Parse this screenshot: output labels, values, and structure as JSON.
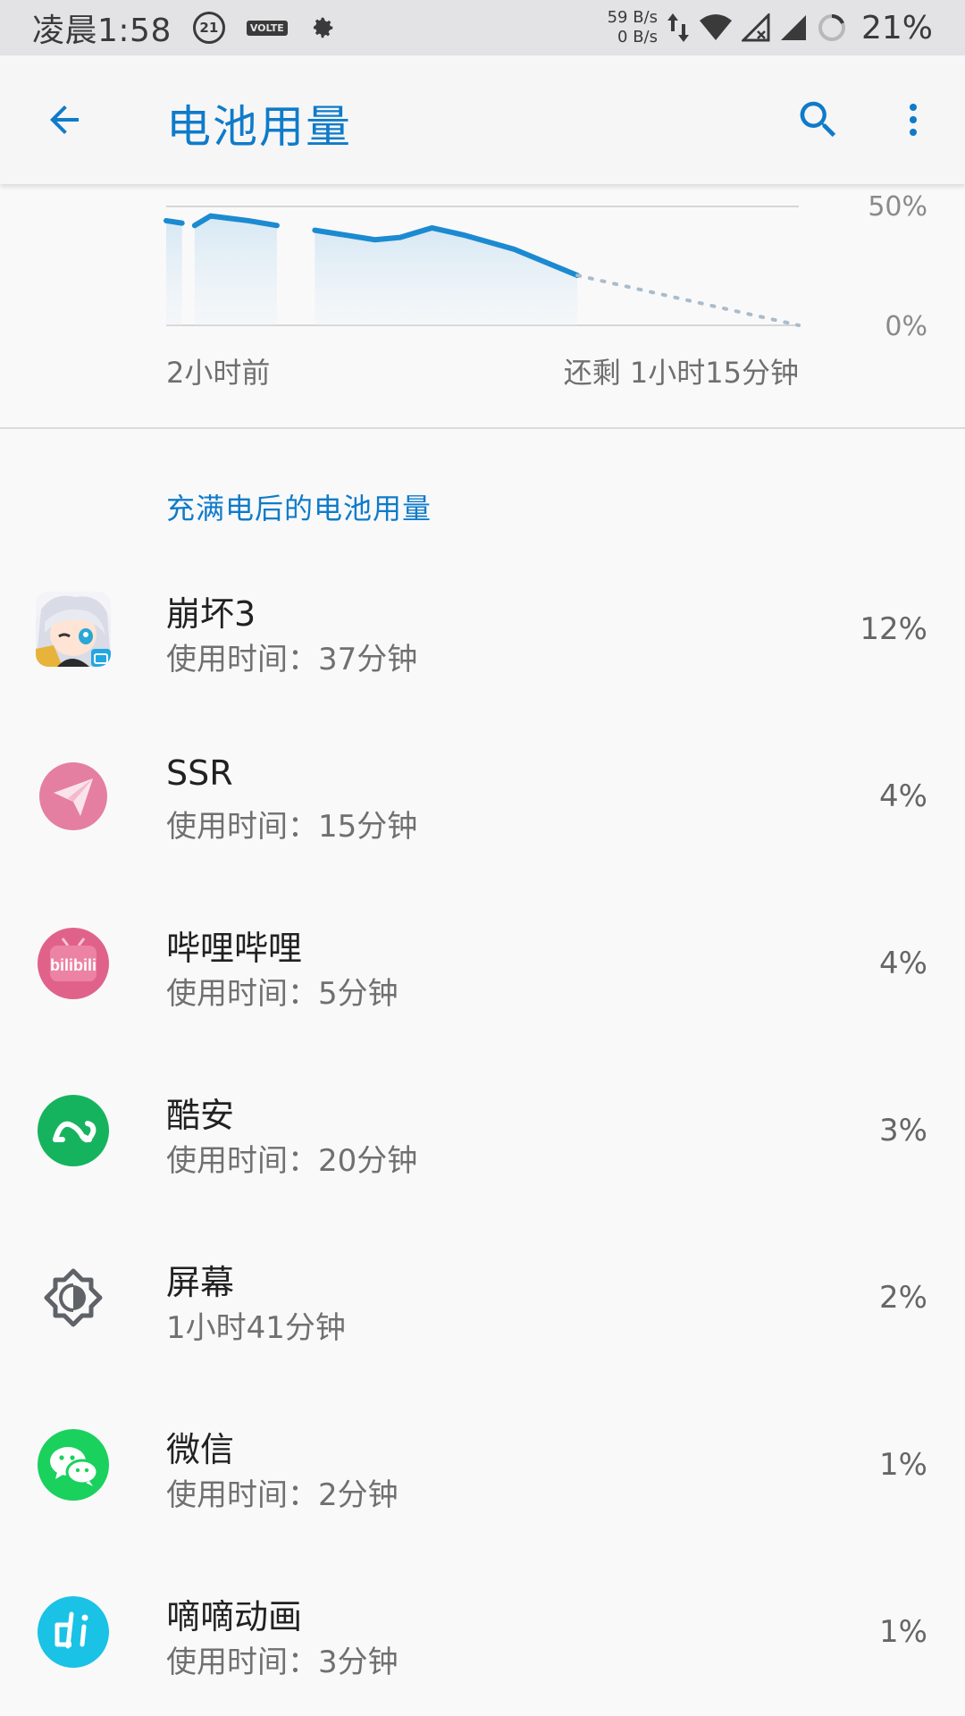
{
  "status_bar": {
    "time": "凌晨1:58",
    "badge_number": "21",
    "volte_label": "VOLTE",
    "net_up": "59 B/s",
    "net_down": "0 B/s",
    "battery_percent": "21%"
  },
  "app_bar": {
    "title": "电池用量"
  },
  "chart": {
    "y_top_label": "50%",
    "y_bottom_label": "0%",
    "x_left_label": "2小时前",
    "x_right_label": "还剩 1小时15分钟"
  },
  "chart_data": {
    "type": "line",
    "title": "",
    "xlabel": "",
    "ylabel": "",
    "ylim": [
      0,
      50
    ],
    "x_labels": [
      "2小时前",
      "还剩 1小时15分钟"
    ],
    "y_labels": [
      "50%",
      "0%"
    ],
    "series": [
      {
        "name": "",
        "style": "solid",
        "values": [
          [
            0,
            44
          ],
          [
            0.025,
            43
          ],
          [
            0.045,
            42
          ],
          [
            0.07,
            46
          ],
          [
            0.13,
            44
          ],
          [
            0.175,
            42
          ],
          [
            0.235,
            40
          ],
          [
            0.33,
            36
          ],
          [
            0.37,
            37
          ],
          [
            0.42,
            41
          ],
          [
            0.47,
            38
          ],
          [
            0.55,
            32
          ],
          [
            0.65,
            21
          ]
        ],
        "gaps_after": [
          1,
          5
        ]
      },
      {
        "name": "",
        "style": "dotted",
        "values": [
          [
            0.65,
            21
          ],
          [
            1.0,
            0
          ]
        ]
      }
    ],
    "color": "#1c8ad1"
  },
  "section": {
    "header": "充满电后的电池用量"
  },
  "apps": [
    {
      "name": "崩坏3",
      "sub": "使用时间：37分钟",
      "pct": "12%",
      "icon": "honkai-icon"
    },
    {
      "name": "SSR",
      "sub": "使用时间：15分钟",
      "pct": "4%",
      "icon": "ssr-icon"
    },
    {
      "name": "哔哩哔哩",
      "sub": "使用时间：5分钟",
      "pct": "4%",
      "icon": "bilibili-icon"
    },
    {
      "name": "酷安",
      "sub": "使用时间：20分钟",
      "pct": "3%",
      "icon": "coolapk-icon"
    },
    {
      "name": "屏幕",
      "sub": "1小时41分钟",
      "pct": "2%",
      "icon": "brightness-icon"
    },
    {
      "name": "微信",
      "sub": "使用时间：2分钟",
      "pct": "1%",
      "icon": "wechat-icon"
    },
    {
      "name": "嘀嘀动画",
      "sub": "使用时间：3分钟",
      "pct": "1%",
      "icon": "didi-anime-icon"
    }
  ],
  "colors": {
    "accent": "#0f7bc9",
    "status_bar_bg": "#e3e3e5",
    "bilibili_pink": "#e0628a",
    "ssr_pink": "#e57fa2",
    "coolapk_green": "#16b35e",
    "wechat_green": "#1ad15e",
    "didi_cyan": "#1ac2e6"
  }
}
